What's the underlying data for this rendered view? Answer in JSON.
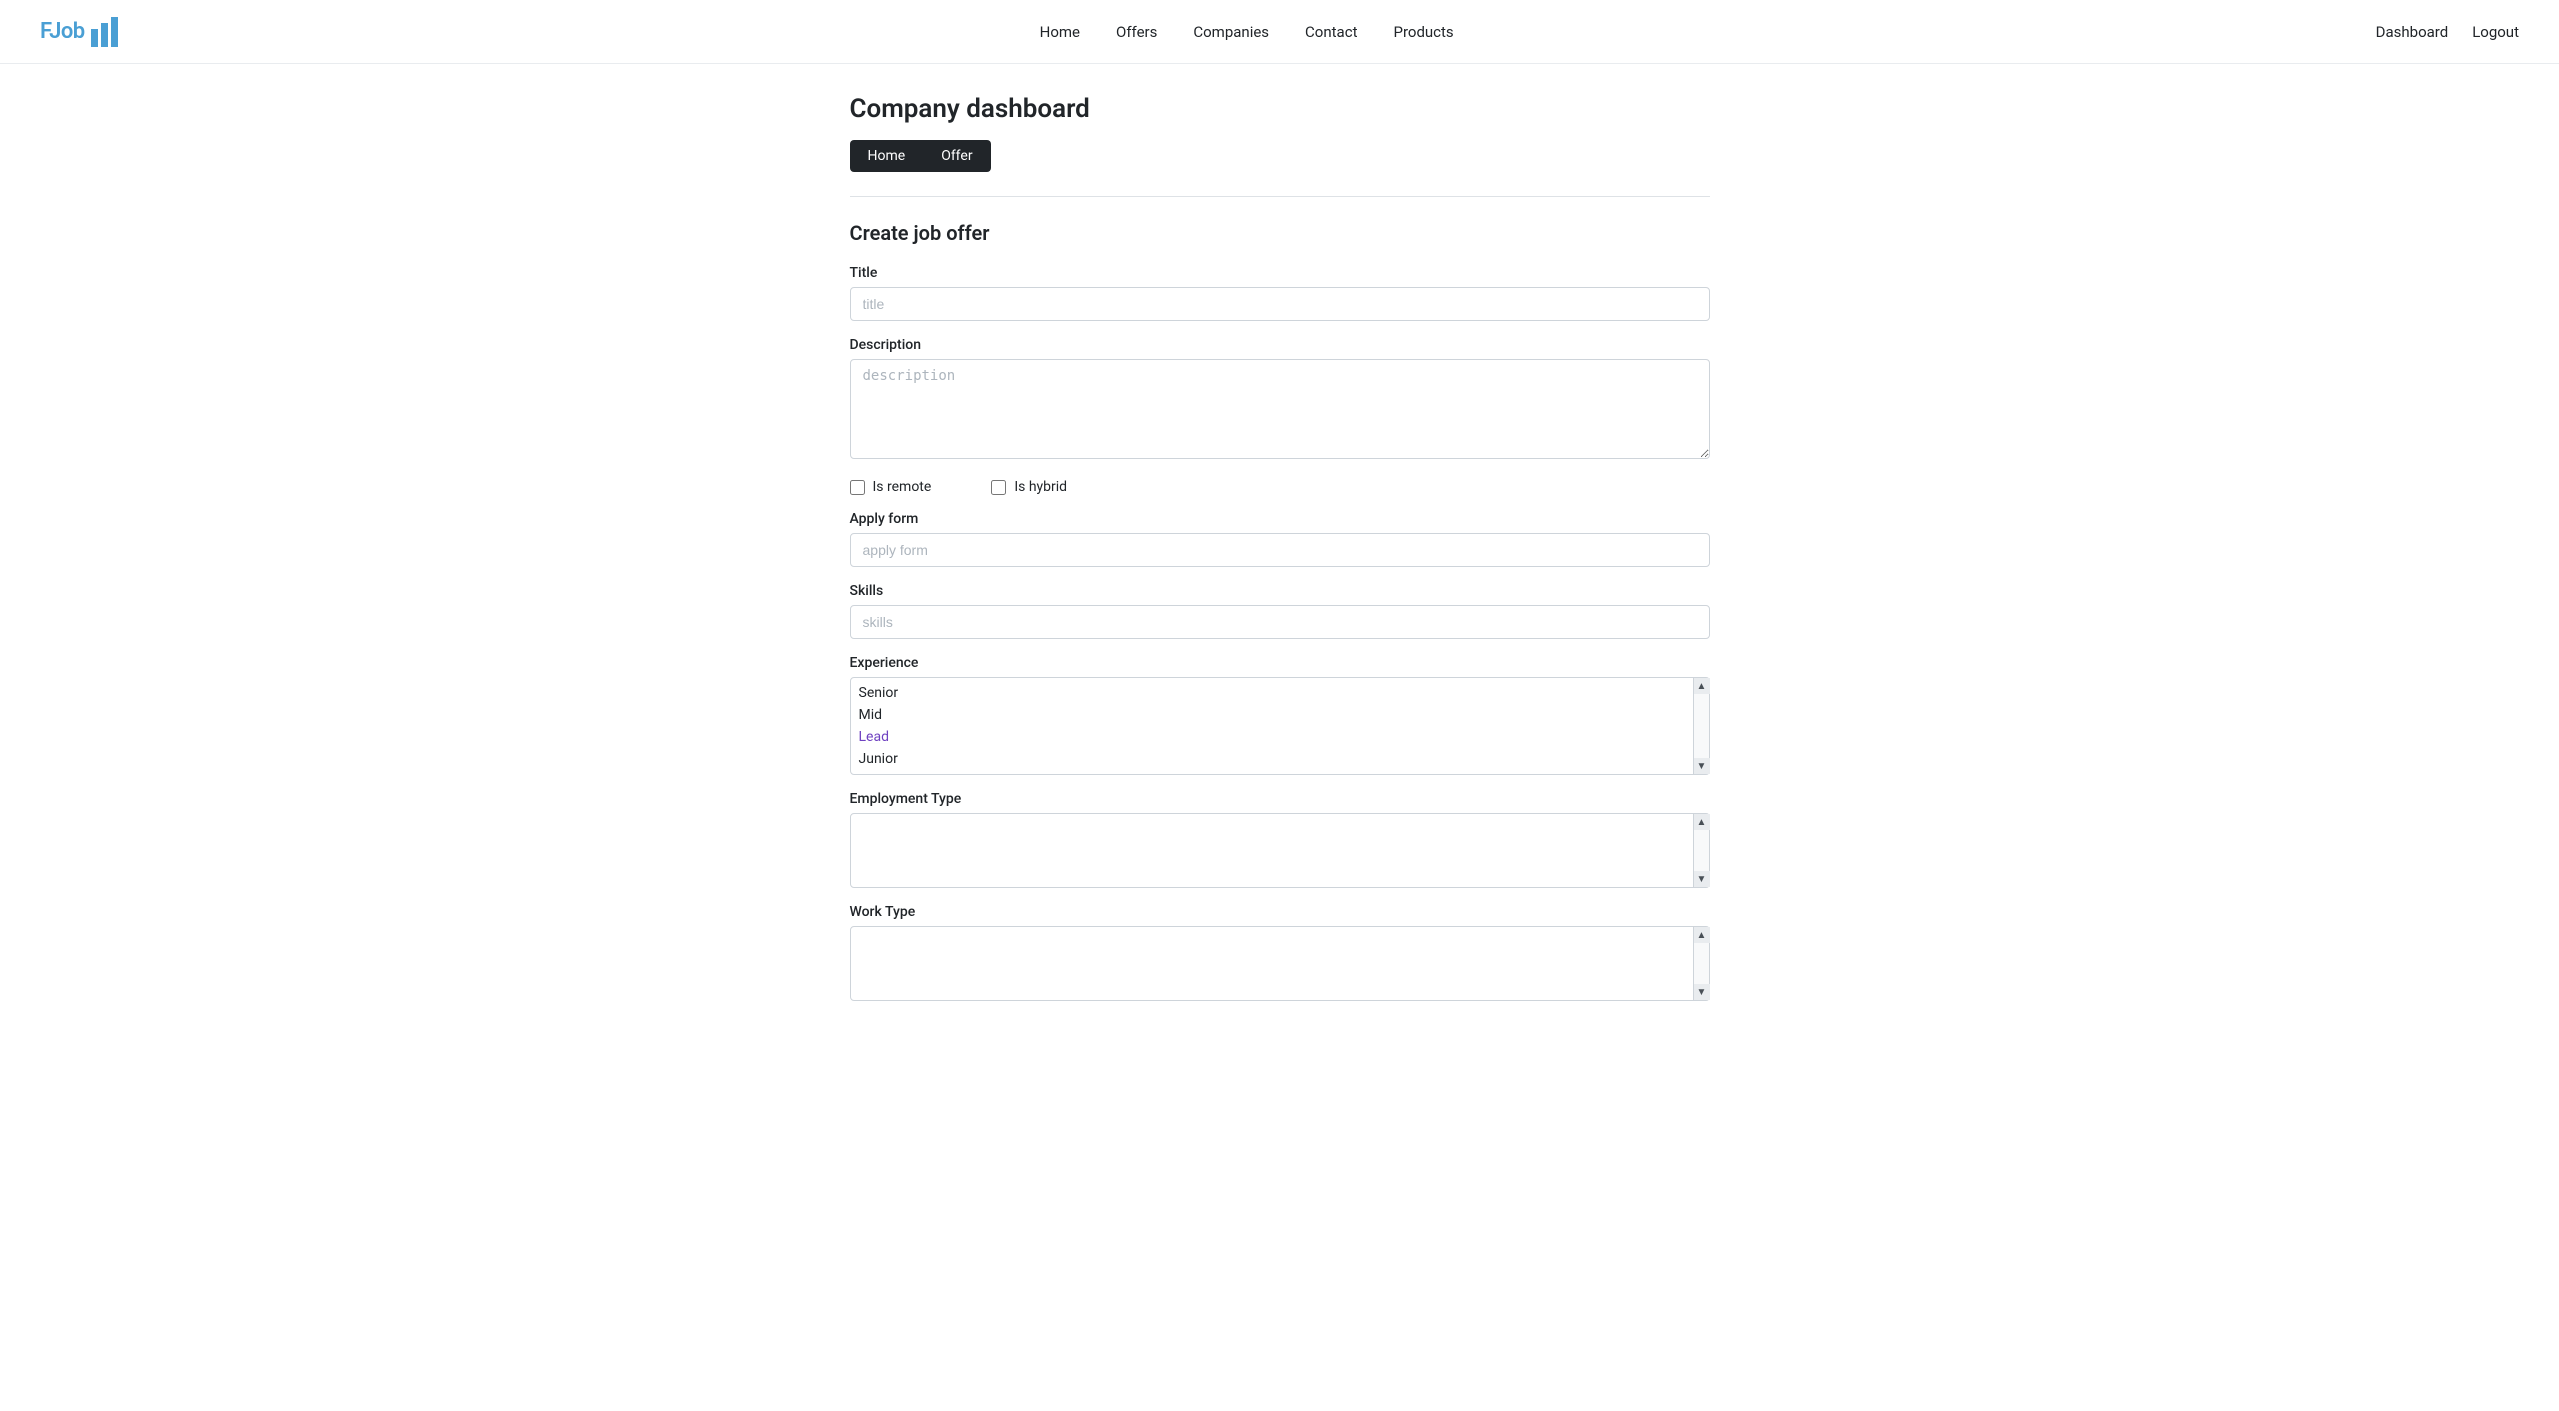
{
  "brand": {
    "name": "FJob",
    "logo_bars": true
  },
  "navbar": {
    "links": [
      {
        "label": "Home",
        "href": "#"
      },
      {
        "label": "Offers",
        "href": "#"
      },
      {
        "label": "Companies",
        "href": "#"
      },
      {
        "label": "Contact",
        "href": "#"
      },
      {
        "label": "Products",
        "href": "#"
      }
    ],
    "right_links": [
      {
        "label": "Dashboard",
        "href": "#"
      },
      {
        "label": "Logout",
        "href": "#"
      }
    ]
  },
  "page": {
    "title": "Company dashboard"
  },
  "breadcrumb": {
    "items": [
      {
        "label": "Home"
      },
      {
        "label": "Offer"
      }
    ]
  },
  "form": {
    "section_title": "Create job offer",
    "fields": {
      "title_label": "Title",
      "title_placeholder": "title",
      "description_label": "Description",
      "description_placeholder": "description",
      "is_remote_label": "Is remote",
      "is_hybrid_label": "Is hybrid",
      "apply_form_label": "Apply form",
      "apply_form_placeholder": "apply form",
      "skills_label": "Skills",
      "skills_placeholder": "skills",
      "experience_label": "Experience",
      "experience_options": [
        {
          "label": "Senior",
          "selected": false
        },
        {
          "label": "Mid",
          "selected": false
        },
        {
          "label": "Lead",
          "selected": false,
          "style": "lead"
        },
        {
          "label": "Junior",
          "selected": false
        }
      ],
      "employment_type_label": "Employment Type",
      "employment_type_options": [],
      "work_type_label": "Work Type",
      "work_type_options": []
    }
  }
}
